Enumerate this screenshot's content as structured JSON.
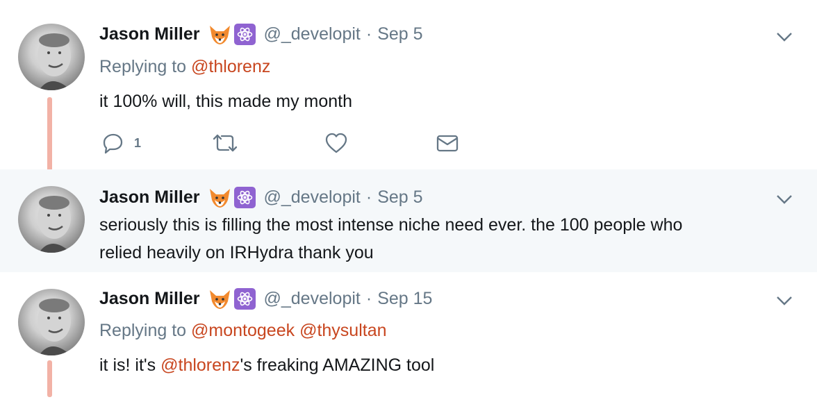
{
  "tweets": [
    {
      "name": "Jason Miller",
      "handle": "@_developit",
      "separator": "·",
      "date": "Sep 5",
      "replying_prefix": "Replying to",
      "replying_to": [
        "@thlorenz"
      ],
      "text": "it 100% will, this made my month",
      "reply_count": "1"
    },
    {
      "name": "Jason Miller",
      "handle": "@_developit",
      "separator": "·",
      "date": "Sep 5",
      "text_line1": "seriously this is filling the most intense niche need ever. the 100 people who",
      "text_line2": "relied heavily on IRHydra thank you"
    },
    {
      "name": "Jason Miller",
      "handle": "@_developit",
      "separator": "·",
      "date": "Sep 15",
      "replying_prefix": "Replying to",
      "replying_to": [
        "@montogeek",
        "@thysultan"
      ],
      "text_before": "it is! it's ",
      "text_mention": "@thlorenz",
      "text_after": "'s freaking AMAZING tool"
    }
  ],
  "icons": {
    "badge1": "fox-emoji-icon",
    "badge2": "atom-react-icon",
    "menu": "chevron-down-icon",
    "reply": "reply-icon",
    "retweet": "retweet-icon",
    "like": "heart-icon",
    "dm": "envelope-icon"
  },
  "colors": {
    "link": "#c8461f",
    "meta": "#657786",
    "thread_line": "#f2b2a6",
    "highlight_bg": "#f5f8fa",
    "react_badge": "#8f63d1"
  }
}
